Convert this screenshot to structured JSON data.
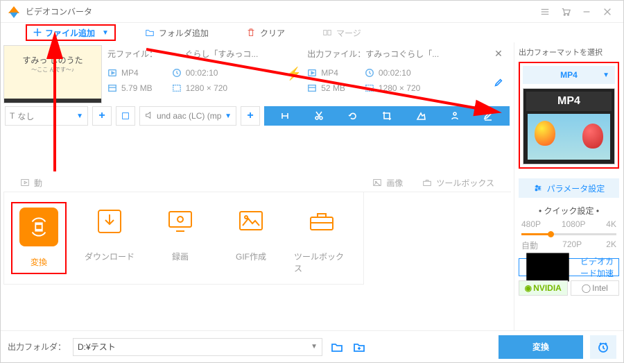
{
  "title": "ビデオコンバータ",
  "toolbar": {
    "add_file": "ファイル追加",
    "add_folder": "フォルダ追加",
    "clear": "クリア",
    "merge": "マージ"
  },
  "file": {
    "thumb_line1": "すみっ      しのうた",
    "thumb_line2": "～ここ           んです～♪",
    "src_title": "元ファイル：    　　　ぐらし「すみっコ...",
    "out_title": "出力ファイル：すみっコぐらし「...",
    "src": {
      "fmt": "MP4",
      "dur": "00:02:10",
      "size": "5.79 MB",
      "res": "1280 × 720"
    },
    "out": {
      "fmt": "MP4",
      "dur": "00:02:10",
      "size": "52 MB",
      "res": "1280 × 720"
    }
  },
  "edit": {
    "subtitle": "なし",
    "audio": "und aac (LC) (mp"
  },
  "tabs": {
    "video": "動 ",
    "image": "画像",
    "tools": "ツールボックス"
  },
  "tiles": {
    "convert": "変換",
    "download": "ダウンロード",
    "record": "録画",
    "gif": "GIF作成",
    "toolbox": "ツールボックス"
  },
  "right": {
    "heading": "出力フォーマットを選択",
    "format": "MP4",
    "format_badge": "MP4",
    "param": "パラメータ設定",
    "quick": "クイック設定",
    "q_top": {
      "a": "480P",
      "b": "1080P",
      "c": "4K"
    },
    "q_bot": {
      "a": "自動",
      "b": "720P",
      "c": "2K"
    },
    "gpu": "ビデオカード加速",
    "nv": "NVIDIA",
    "it": "Intel"
  },
  "footer": {
    "label": "出力フォルダ：",
    "path": "D:¥テスト",
    "convert": "変換"
  }
}
